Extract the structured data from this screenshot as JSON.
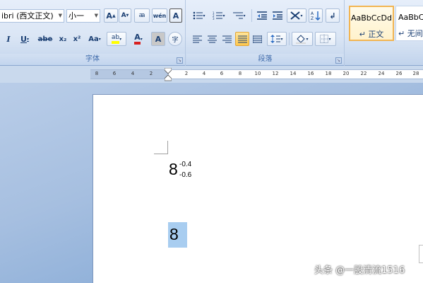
{
  "font_group": {
    "font_name": "ibri (西文正文)",
    "font_size": "小一",
    "grow_label": "A",
    "shrink_label": "A",
    "clear_label": "ꜳ",
    "phonetic_label": "wén",
    "border_char_label": "A",
    "italic_label": "I",
    "underline_label": "U",
    "strike_label": "abe",
    "subscript_label": "x₂",
    "superscript_label": "x²",
    "case_label": "Aa",
    "highlight_label": "ab",
    "font_color_label": "A",
    "shading_label": "A",
    "enclose_label": "字",
    "group_label": "字体"
  },
  "paragraph_group": {
    "group_label": "段落"
  },
  "styles": [
    {
      "sample": "AaBbCcDd",
      "name": "↵ 正文"
    },
    {
      "sample": "AaBbCc",
      "name": "↵ 无间"
    }
  ],
  "ruler": {
    "labels": [
      "8",
      "6",
      "4",
      "2",
      "2",
      "4",
      "6",
      "8",
      "10",
      "12",
      "14",
      "16",
      "18",
      "20",
      "22",
      "24",
      "26",
      "28"
    ]
  },
  "document": {
    "base_digit": "8",
    "superscript": "-0.4",
    "subscript": "-0.6",
    "selected_text": "8"
  },
  "watermark": "头条 @一股清流1516",
  "colors": {
    "accent_highlight": "#ffff00",
    "font_color": "#d82020",
    "selected_style_border": "#f2b552",
    "selection_bg": "#a8cdf0"
  }
}
